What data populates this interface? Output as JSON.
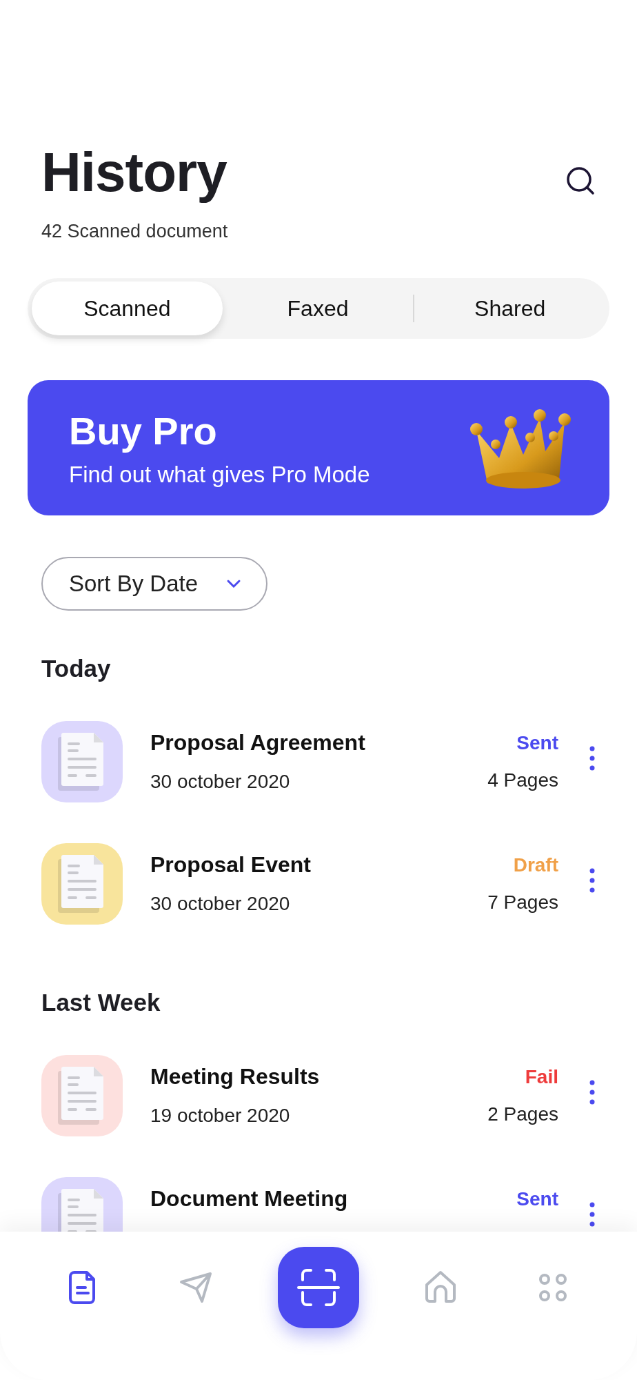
{
  "header": {
    "title": "History",
    "subtitle": "42 Scanned document"
  },
  "tabs": [
    {
      "label": "Scanned",
      "selected": true
    },
    {
      "label": "Faxed",
      "selected": false
    },
    {
      "label": "Shared",
      "selected": false
    }
  ],
  "banner": {
    "title": "Buy Pro",
    "text": "Find out what gives Pro Mode"
  },
  "sort": {
    "value": "Sort By Date"
  },
  "sections": [
    {
      "heading": "Today",
      "items": [
        {
          "title": "Proposal Agreement",
          "date": "30 october 2020",
          "status": {
            "text": "Sent",
            "color": "#4b4aef"
          },
          "pages": "4 Pages",
          "color": "#dcd7fd"
        },
        {
          "title": "Proposal Event",
          "date": "30 october 2020",
          "status": {
            "text": "Draft",
            "color": "#f0a048"
          },
          "pages": "7 Pages",
          "color": "#f8e49c"
        }
      ]
    },
    {
      "heading": "Last Week",
      "items": [
        {
          "title": "Meeting Results",
          "date": "19 october 2020",
          "status": {
            "text": "Fail",
            "color": "#ee3b3b"
          },
          "pages": "2 Pages",
          "color": "#fde0de"
        },
        {
          "title": "Document Meeting",
          "status": {
            "text": "Sent",
            "color": "#4b4aef"
          },
          "color": "#dcd7fd"
        }
      ]
    }
  ],
  "nav_items": [
    {
      "kind": "tab",
      "selected": true
    },
    {
      "kind": "tab",
      "selected": false
    },
    {
      "kind": "scan"
    },
    {
      "kind": "tab",
      "selected": false
    },
    {
      "kind": "tab",
      "selected": false
    }
  ]
}
